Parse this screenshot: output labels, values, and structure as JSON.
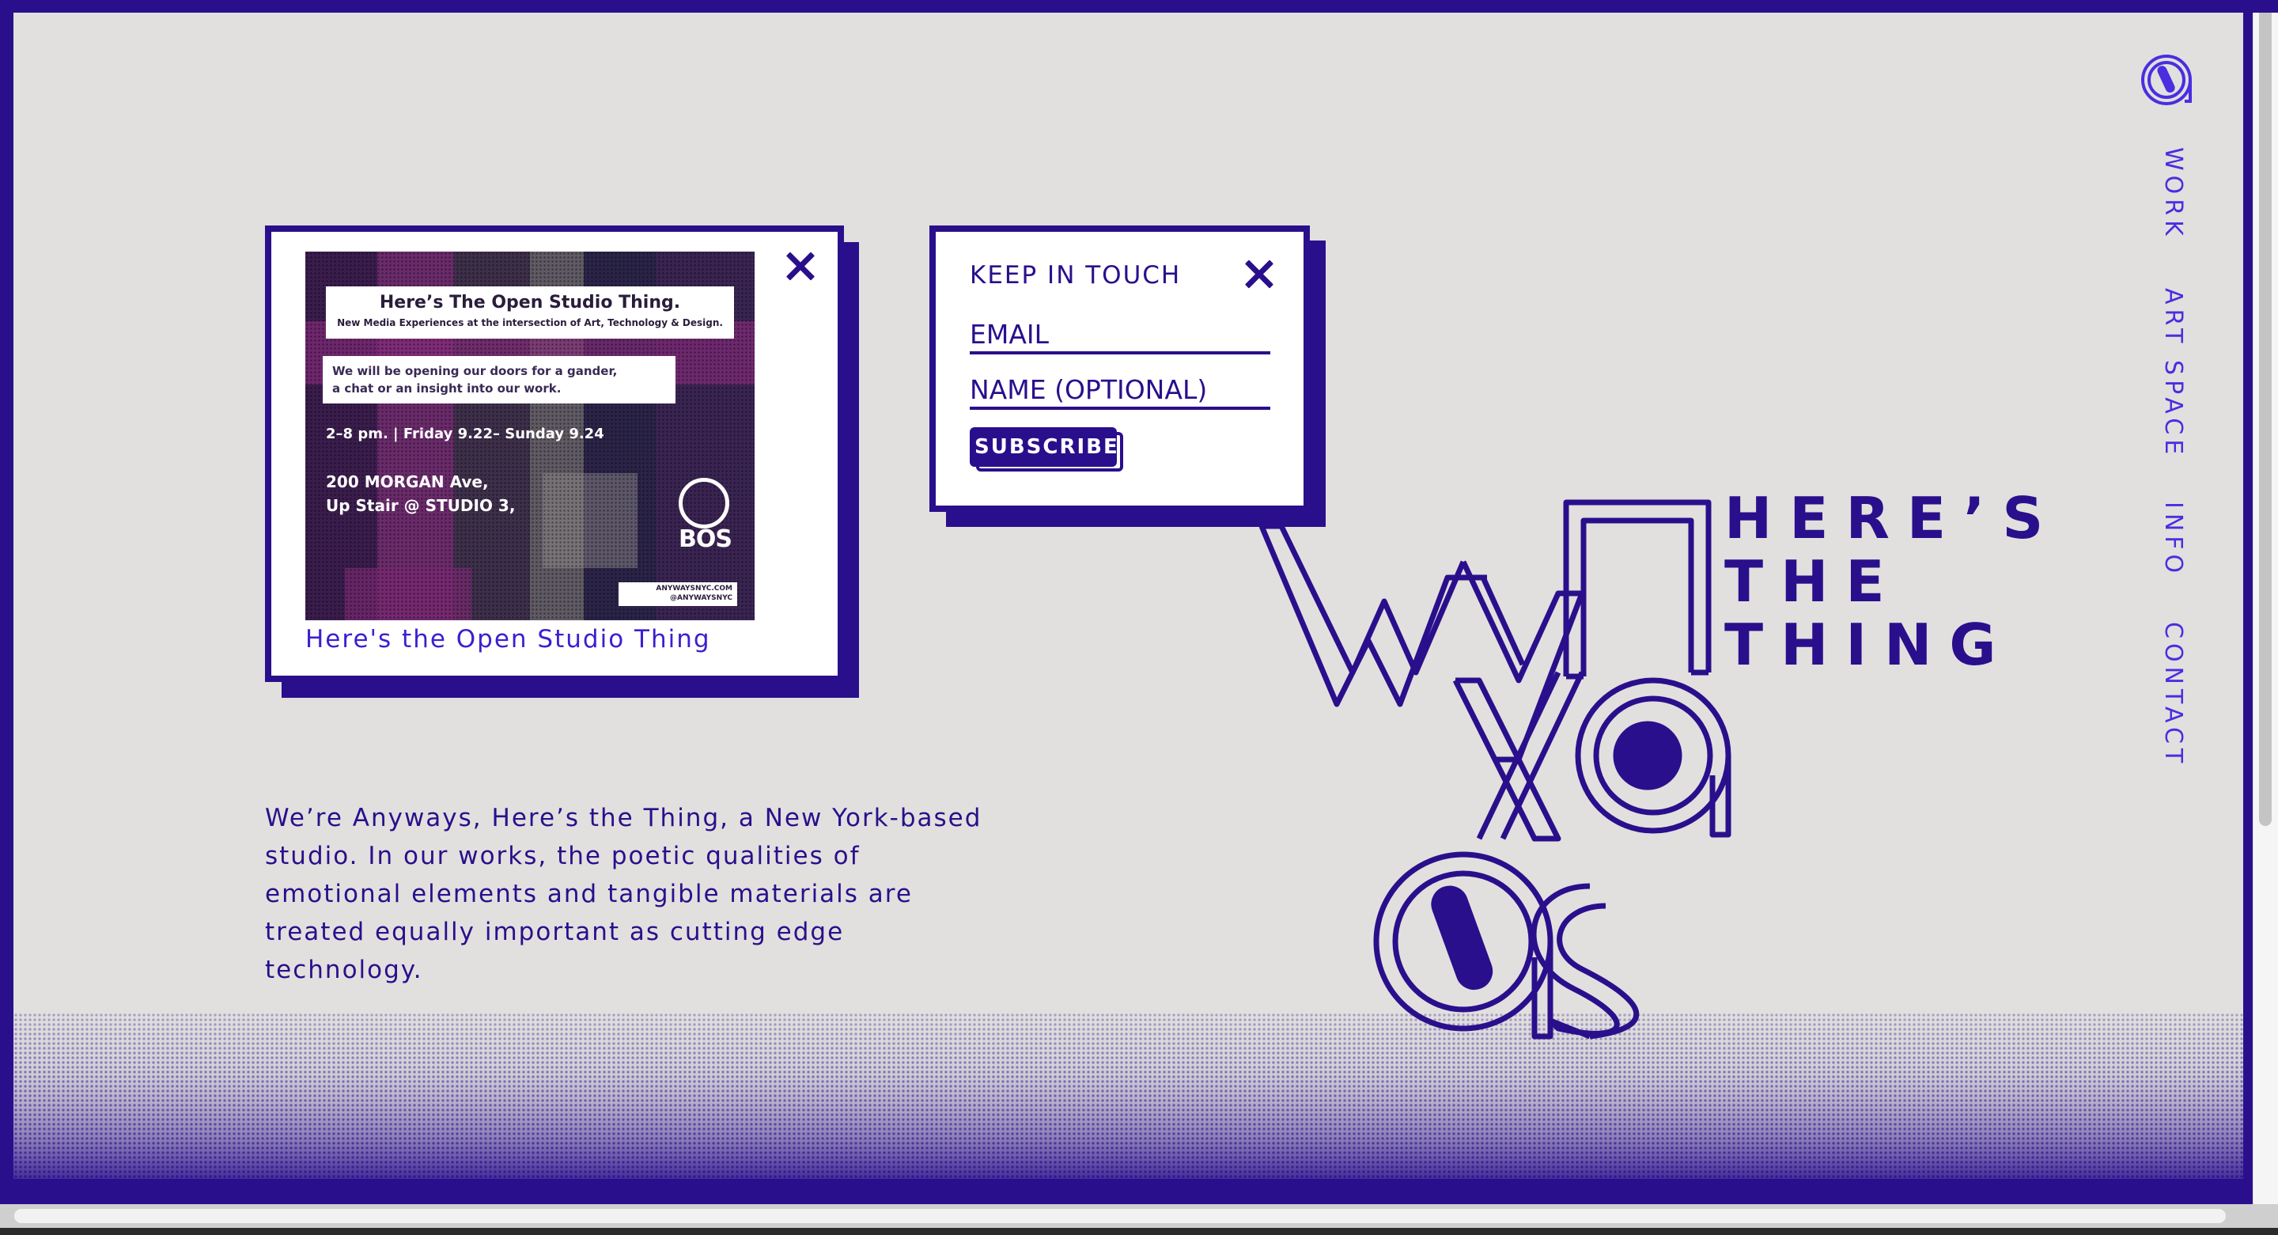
{
  "colors": {
    "brand": "#2a0f8c",
    "link": "#3a20d0",
    "background": "#e1e0de"
  },
  "nav": {
    "logo_icon": "anyways-logo-icon",
    "items": [
      "WORK",
      "ART SPACE",
      "INFO",
      "CONTACT"
    ]
  },
  "event_card": {
    "close_icon": "close-icon",
    "caption": "Here's the Open Studio Thing",
    "flyer": {
      "title": "Here’s The Open Studio Thing.",
      "subtitle": "New Media Experiences at the intersection of Art, Technology & Design.",
      "blurb_line1": "We will be opening our doors for a gander,",
      "blurb_line2": "a chat or an insight into our work.",
      "when": "2–8 pm.  |  Friday 9.22– Sunday 9.24",
      "addr_line1": "200 MORGAN Ave,",
      "addr_line2": "Up Stair @ STUDIO 3,",
      "logo_text": "BOS",
      "tag_line1": "ANYWAYSNYC.COM",
      "tag_line2": "@ANYWAYSNYC"
    }
  },
  "subscribe_card": {
    "heading": "KEEP IN TOUCH",
    "close_icon": "close-icon",
    "email_placeholder": "EMAIL",
    "name_placeholder": "NAME (OPTIONAL)",
    "button_label": "SUBSCRIBE"
  },
  "intro": {
    "line1": "We’re Anyways, Here’s the Thing, a New York-based",
    "line2": "studio. In our works, the poetic qualities of",
    "line3": "emotional elements and tangible materials are",
    "line4": "treated equally important as cutting edge",
    "line5": "technology."
  },
  "wordmark": {
    "line1": "HERE’S",
    "line2": "THE",
    "line3": "THING"
  }
}
